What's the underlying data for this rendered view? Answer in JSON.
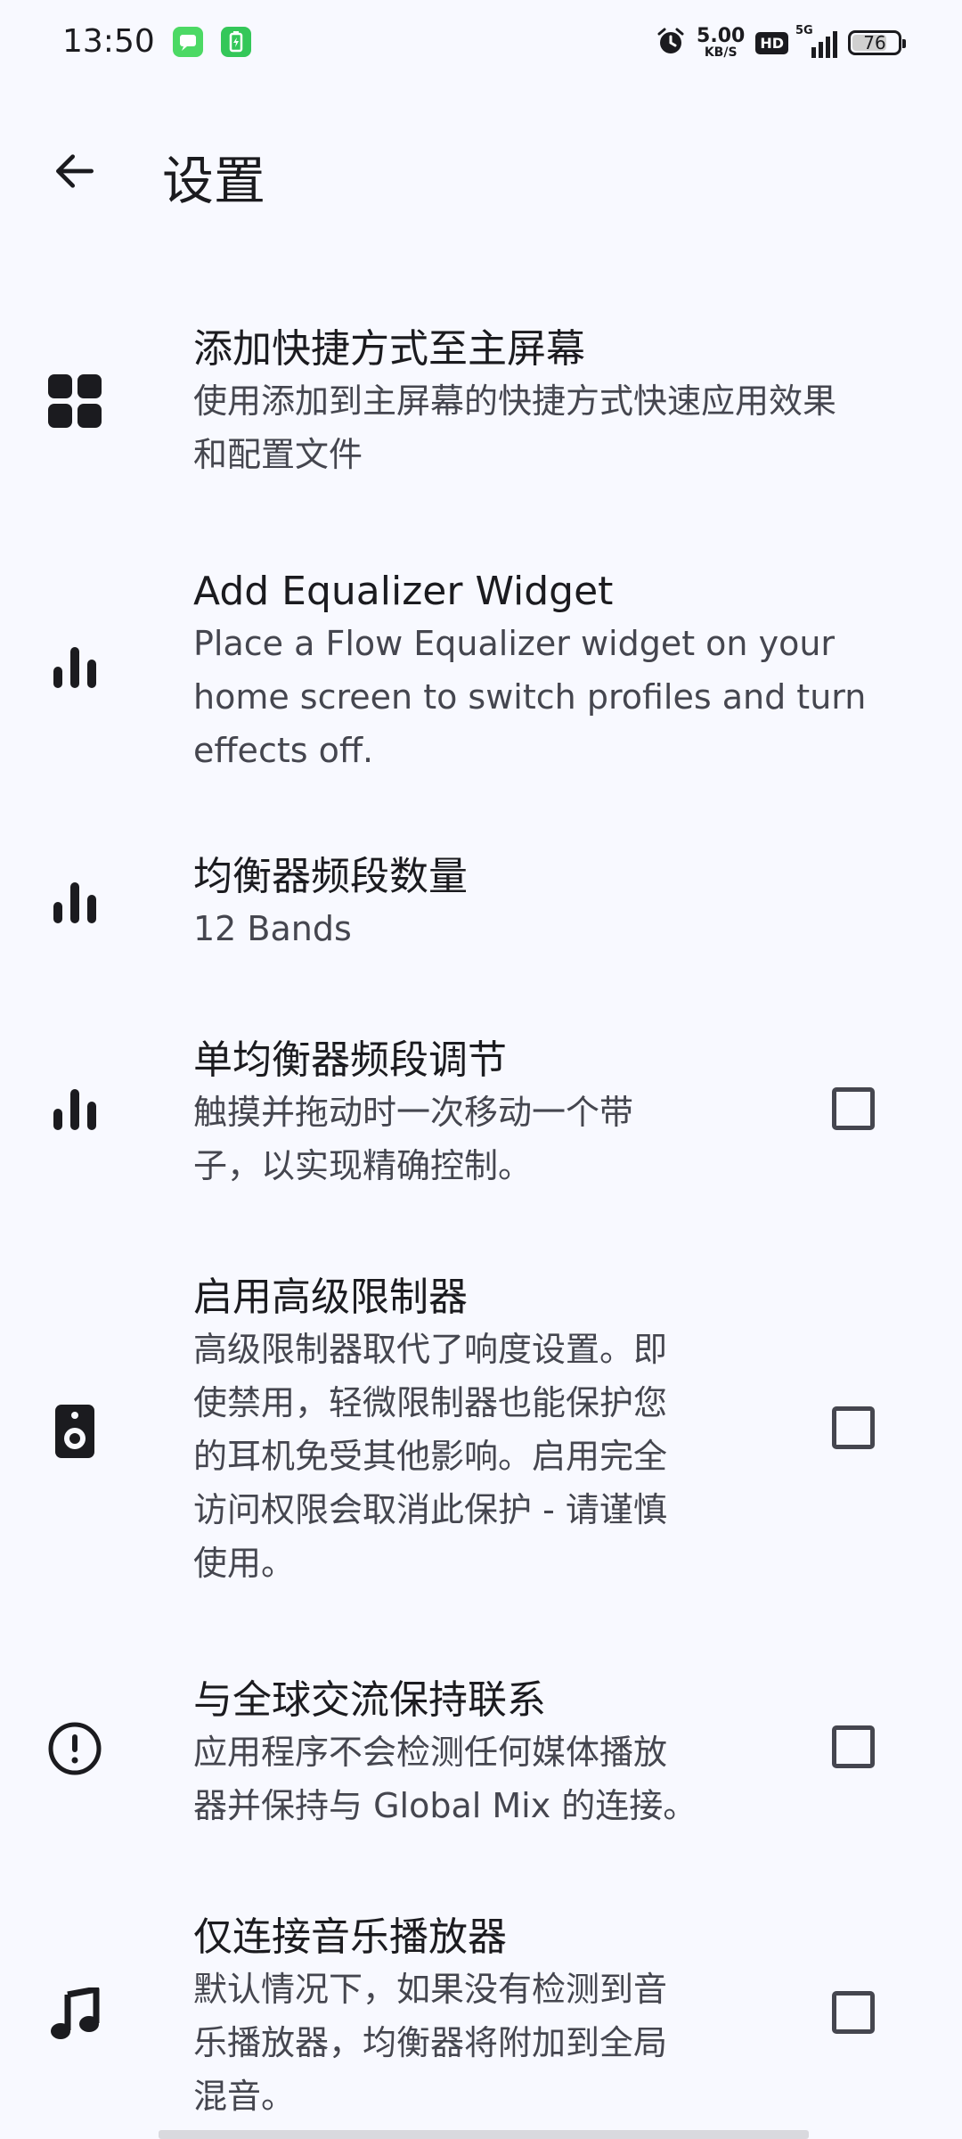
{
  "status_bar": {
    "time": "13:50",
    "net_speed_value": "5.00",
    "net_speed_unit": "KB/S",
    "hd_label": "HD",
    "network_type": "5G",
    "battery_level": "76",
    "battery_percent": 76,
    "icons": [
      "message-notification-icon",
      "battery-app-notification-icon",
      "alarm-icon",
      "signal-icon"
    ]
  },
  "app_bar": {
    "title": "设置",
    "back_icon": "arrow-left-icon"
  },
  "settings": [
    {
      "id": "add-shortcut",
      "icon": "grid-icon",
      "title": "添加快捷方式至主屏幕",
      "subtitle_lines": [
        "使用添加到主屏幕的快捷方式快速应用效果",
        "和配置文件"
      ],
      "has_checkbox": false
    },
    {
      "id": "add-widget",
      "icon": "equalizer-icon",
      "title": "Add Equalizer Widget",
      "subtitle_lines": [
        "Place a Flow Equalizer widget on your",
        "home screen to switch profiles and turn",
        "effects off."
      ],
      "has_checkbox": false
    },
    {
      "id": "band-count",
      "icon": "equalizer-icon",
      "title": "均衡器频段数量",
      "subtitle_lines": [
        "12 Bands"
      ],
      "has_checkbox": false
    },
    {
      "id": "single-band",
      "icon": "equalizer-icon",
      "title": "单均衡器频段调节",
      "subtitle_lines": [
        "触摸并拖动时一次移动一个带",
        "子，以实现精确控制。"
      ],
      "has_checkbox": true,
      "checked": false
    },
    {
      "id": "advanced-limiter",
      "icon": "speaker-icon",
      "title": "启用高级限制器",
      "subtitle_lines": [
        "高级限制器取代了响度设置。即",
        "使禁用，轻微限制器也能保护您",
        "的耳机免受其他影响。启用完全",
        "访问权限会取消此保护 - 请谨慎",
        "使用。"
      ],
      "has_checkbox": true,
      "checked": false
    },
    {
      "id": "global-mix",
      "icon": "alert-circle-icon",
      "title": "与全球交流保持联系",
      "subtitle_lines": [
        "应用程序不会检测任何媒体播放",
        "器并保持与 Global Mix 的连接。"
      ],
      "has_checkbox": true,
      "checked": false
    },
    {
      "id": "music-only",
      "icon": "music-note-icon",
      "title": "仅连接音乐播放器",
      "subtitle_lines": [
        "默认情况下，如果没有检测到音",
        "乐播放器，均衡器将附加到全局",
        "混音。"
      ],
      "has_checkbox": true,
      "checked": false
    }
  ]
}
